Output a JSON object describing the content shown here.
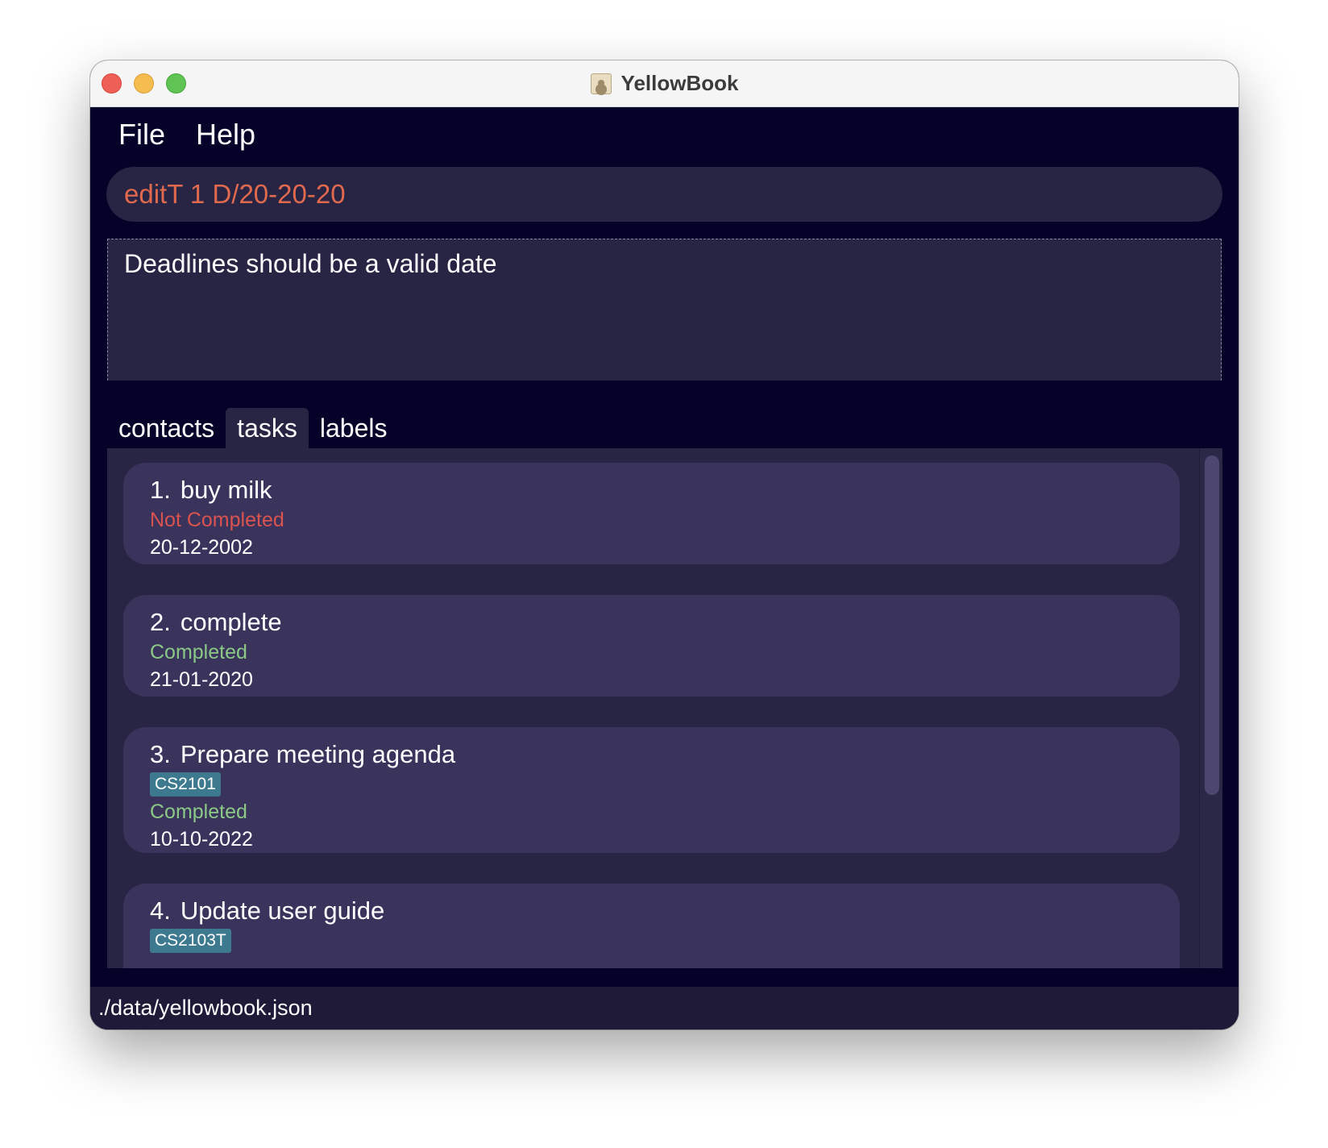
{
  "window": {
    "title": "YellowBook",
    "app_icon": "contact-book-icon"
  },
  "menu": {
    "items": [
      {
        "label": "File"
      },
      {
        "label": "Help"
      }
    ]
  },
  "command": {
    "value": "editT 1 D/20-20-20",
    "color": "#e16a4e"
  },
  "result": {
    "message": "Deadlines should be a valid date"
  },
  "tabs": [
    {
      "label": "contacts",
      "active": false
    },
    {
      "label": "tasks",
      "active": true
    },
    {
      "label": "labels",
      "active": false
    }
  ],
  "tasks": [
    {
      "index": "1.",
      "title": "buy milk",
      "labels": [],
      "status": "Not Completed",
      "status_color": "#d9534f",
      "deadline": "20-12-2002"
    },
    {
      "index": "2.",
      "title": "complete",
      "labels": [],
      "status": "Completed",
      "status_color": "#8bc986",
      "deadline": "21-01-2020"
    },
    {
      "index": "3.",
      "title": "Prepare meeting agenda",
      "labels": [
        "CS2101"
      ],
      "status": "Completed",
      "status_color": "#8bc986",
      "deadline": "10-10-2022"
    },
    {
      "index": "4.",
      "title": "Update user guide",
      "labels": [
        "CS2103T"
      ],
      "status": "",
      "deadline": ""
    }
  ],
  "status_bar": {
    "path": "./data/yellowbook.json"
  }
}
